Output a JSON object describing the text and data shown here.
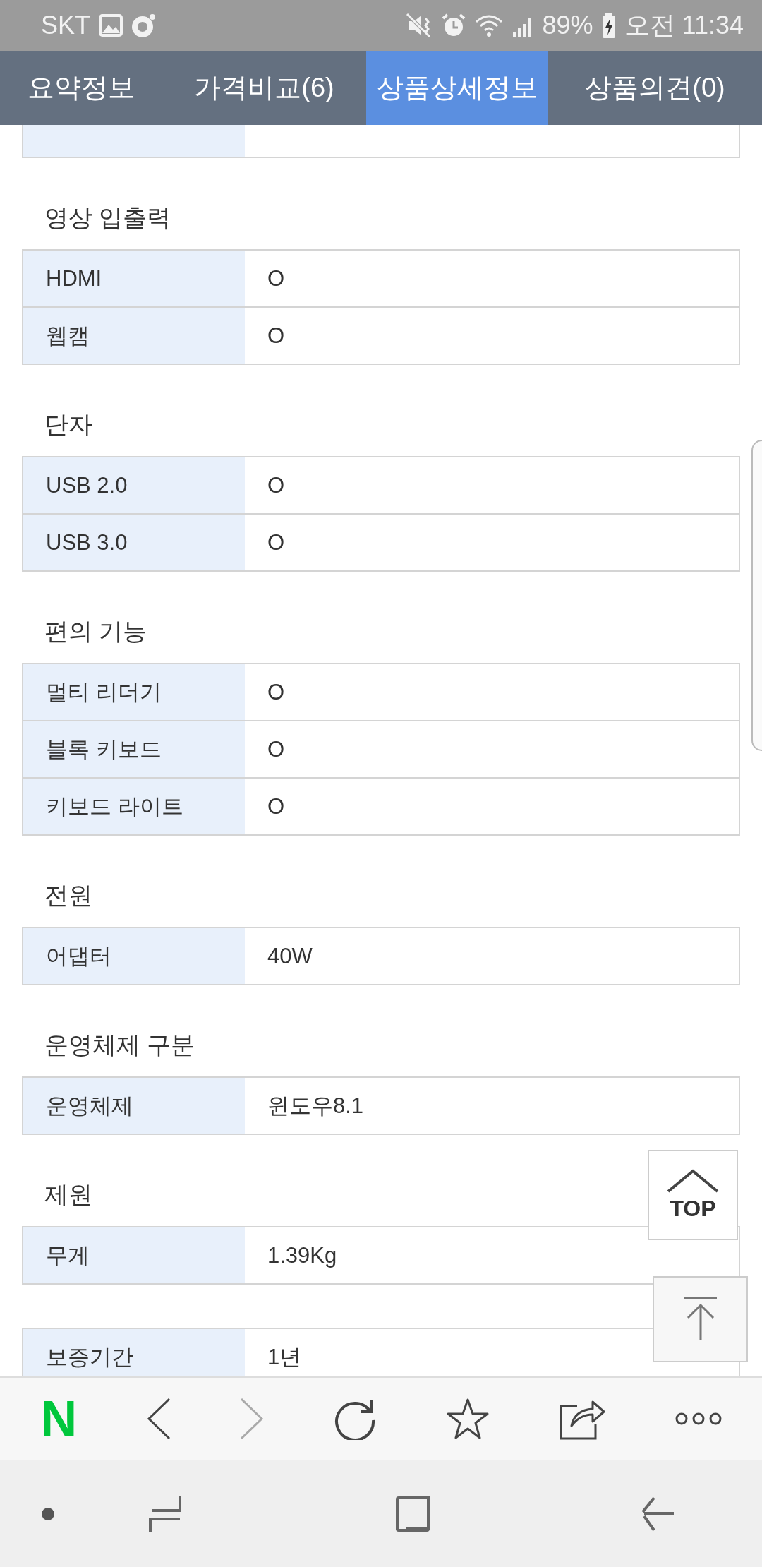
{
  "status_bar": {
    "carrier": "SKT",
    "battery": "89%",
    "time": "오전 11:34"
  },
  "tabs": [
    {
      "label": "요약정보",
      "selected": false
    },
    {
      "label": "가격비교(6)",
      "selected": false
    },
    {
      "label": "상품상세정보",
      "selected": true
    },
    {
      "label": "상품의견(0)",
      "selected": false
    }
  ],
  "sections": [
    {
      "title": "영상 입출력",
      "rows": [
        {
          "label": "HDMI",
          "value": "O"
        },
        {
          "label": "웹캠",
          "value": "O"
        }
      ]
    },
    {
      "title": "단자",
      "rows": [
        {
          "label": "USB 2.0",
          "value": "O"
        },
        {
          "label": "USB 3.0",
          "value": "O"
        }
      ]
    },
    {
      "title": "편의 기능",
      "rows": [
        {
          "label": "멀티 리더기",
          "value": "O"
        },
        {
          "label": "블록 키보드",
          "value": "O"
        },
        {
          "label": "키보드 라이트",
          "value": "O"
        }
      ]
    },
    {
      "title": "전원",
      "rows": [
        {
          "label": "어댑터",
          "value": "40W"
        }
      ]
    },
    {
      "title": "운영체제 구분",
      "rows": [
        {
          "label": "운영체제",
          "value": "윈도우8.1"
        }
      ]
    },
    {
      "title": "제원",
      "rows": [
        {
          "label": "무게",
          "value": "1.39Kg"
        }
      ]
    },
    {
      "rows": [
        {
          "label": "보증기간",
          "value": "1년"
        }
      ]
    }
  ],
  "top_button": {
    "label": "TOP"
  },
  "browser_toolbar": {
    "logo": "N"
  }
}
